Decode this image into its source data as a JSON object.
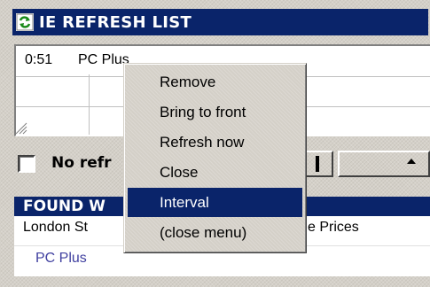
{
  "window": {
    "title": "IE REFRESH LIST",
    "icon": "refresh-icon"
  },
  "refresh_list": {
    "rows": [
      {
        "time": "0:51",
        "name": "PC Plus"
      }
    ]
  },
  "options": {
    "checkbox_label": "No refr",
    "checked": false
  },
  "found": {
    "header": "FOUND W",
    "items": [
      {
        "left": "London St",
        "right": "e Prices"
      },
      {
        "left": "PC Plus"
      }
    ]
  },
  "context_menu": {
    "items": [
      {
        "label": "Remove"
      },
      {
        "label": "Bring to front"
      },
      {
        "label": "Refresh now"
      },
      {
        "label": "Close"
      },
      {
        "label": "Interval",
        "selected": true
      },
      {
        "label": "(close menu)"
      }
    ]
  },
  "colors": {
    "title_bg": "#0a246a",
    "face": "#d4d0c8",
    "highlight": "#0a246a",
    "link": "#4040a0"
  }
}
